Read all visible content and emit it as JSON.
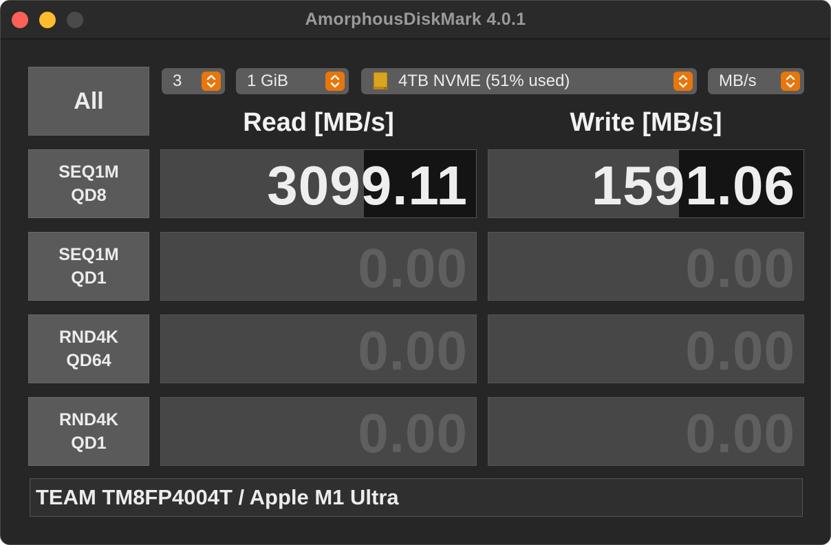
{
  "window": {
    "title": "AmorphousDiskMark 4.0.1"
  },
  "controls": {
    "all_label": "All",
    "count": "3",
    "size": "1 GiB",
    "drive": "4TB NVME (51% used)",
    "unit": "MB/s",
    "accent": "#e8760a"
  },
  "headers": {
    "read": "Read [MB/s]",
    "write": "Write [MB/s]"
  },
  "tests": [
    {
      "line1": "SEQ1M",
      "line2": "QD8",
      "read": "3099.11",
      "write": "1591.06",
      "read_fill": 0.645,
      "write_fill": 0.605
    },
    {
      "line1": "SEQ1M",
      "line2": "QD1",
      "read": "0.00",
      "write": "0.00",
      "read_fill": 0,
      "write_fill": 0
    },
    {
      "line1": "RND4K",
      "line2": "QD64",
      "read": "0.00",
      "write": "0.00",
      "read_fill": 0,
      "write_fill": 0
    },
    {
      "line1": "RND4K",
      "line2": "QD1",
      "read": "0.00",
      "write": "0.00",
      "read_fill": 0,
      "write_fill": 0
    }
  ],
  "footer": {
    "info": "TEAM TM8FP4004T / Apple M1 Ultra"
  }
}
